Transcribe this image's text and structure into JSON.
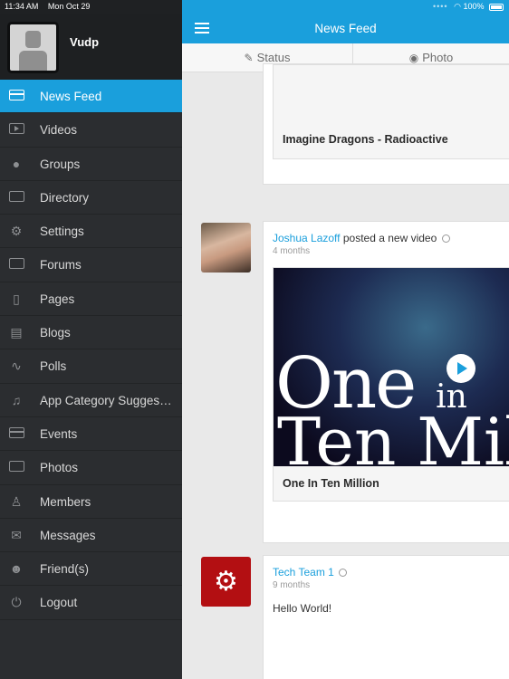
{
  "statusbar": {
    "time": "11:34 AM",
    "date": "Mon Oct 29",
    "battery": "100%"
  },
  "profile": {
    "name": "Vudp"
  },
  "menu": [
    {
      "label": "News Feed",
      "icon": "news-feed-icon",
      "active": true
    },
    {
      "label": "Videos",
      "icon": "video-icon"
    },
    {
      "label": "Groups",
      "icon": "groups-icon"
    },
    {
      "label": "Directory",
      "icon": "directory-icon"
    },
    {
      "label": "Settings",
      "icon": "settings-icon"
    },
    {
      "label": "Forums",
      "icon": "forums-icon"
    },
    {
      "label": "Pages",
      "icon": "pages-icon"
    },
    {
      "label": "Blogs",
      "icon": "blogs-icon"
    },
    {
      "label": "Polls",
      "icon": "polls-icon"
    },
    {
      "label": "App Category Sugges…",
      "icon": "music-note-icon"
    },
    {
      "label": "Events",
      "icon": "calendar-icon"
    },
    {
      "label": "Photos",
      "icon": "photos-icon"
    },
    {
      "label": "Members",
      "icon": "members-icon"
    },
    {
      "label": "Messages",
      "icon": "envelope-icon"
    },
    {
      "label": "Friend(s)",
      "icon": "friends-icon"
    },
    {
      "label": "Logout",
      "icon": "power-icon"
    }
  ],
  "header": {
    "title": "News Feed",
    "status_label": "Status",
    "photo_label": "Photo"
  },
  "posts": [
    {
      "caption": "Imagine Dragons - Radioactive"
    },
    {
      "author": "Joshua Lazoff",
      "action": "posted a new video",
      "time": "4 months",
      "thumb_line1": "One",
      "thumb_in": "in",
      "thumb_line2": "Ten Mil",
      "caption": "One In Ten Million"
    },
    {
      "author": "Tech Team 1",
      "time": "9 months",
      "text": "Hello World!"
    }
  ],
  "colors": {
    "accent": "#1a9fdc",
    "sidebar": "#2b2d30",
    "tech_avatar": "#b30f12"
  }
}
